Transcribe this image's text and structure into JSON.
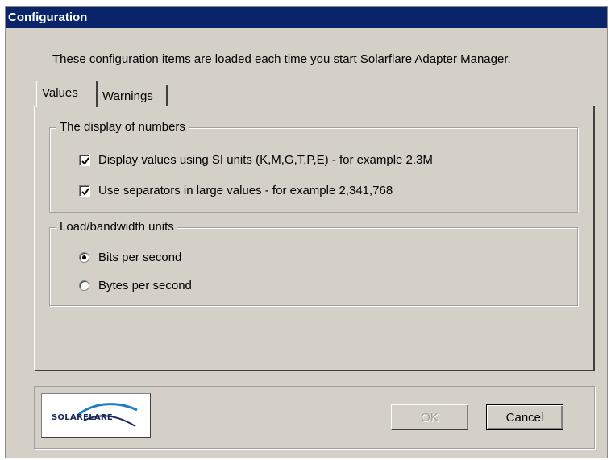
{
  "window": {
    "title": "Configuration"
  },
  "intro_text": "These configuration items are loaded each time you start Solarflare Adapter Manager.",
  "tabs": [
    {
      "label": "Values",
      "active": true
    },
    {
      "label": "Warnings",
      "active": false
    }
  ],
  "display_group": {
    "legend": "The display of numbers",
    "options": [
      {
        "label": "Display values using SI units (K,M,G,T,P,E) - for example 2.3M",
        "checked": true
      },
      {
        "label": "Use separators in large values - for example 2,341,768",
        "checked": true
      }
    ]
  },
  "units_group": {
    "legend": "Load/bandwidth units",
    "options": [
      {
        "label": "Bits per second",
        "selected": true
      },
      {
        "label": "Bytes per second",
        "selected": false
      }
    ]
  },
  "logo": {
    "text": "SOLARFLARE",
    "icon": "solarflare-logo-icon"
  },
  "buttons": {
    "ok": "OK",
    "cancel": "Cancel"
  },
  "colors": {
    "titlebar": "#0a246a",
    "dialog_bg": "#d4d0c8",
    "logo_blue": "#1f7fc4"
  }
}
